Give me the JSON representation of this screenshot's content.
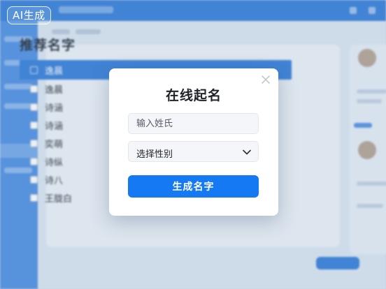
{
  "badge": {
    "label": "AI生成"
  },
  "background": {
    "heading": "推荐名字",
    "names": [
      "逸晨",
      "逸晨",
      "诗涵",
      "诗涵",
      "奕萌",
      "诗纵",
      "诗八",
      "王胧白"
    ],
    "selected_index": 0
  },
  "modal": {
    "title": "在线起名",
    "surname_placeholder": "输入姓氏",
    "surname_value": "",
    "gender_selected": "选择性别",
    "generate_label": "生成名字"
  },
  "colors": {
    "primary": "#1479f2",
    "background_topbar": "#2f79d6",
    "sidebar": "#4a8ce0",
    "selected_row": "#2f79d6"
  },
  "icons": {
    "close": "close-icon",
    "dropdown": "chevron-down-icon"
  }
}
